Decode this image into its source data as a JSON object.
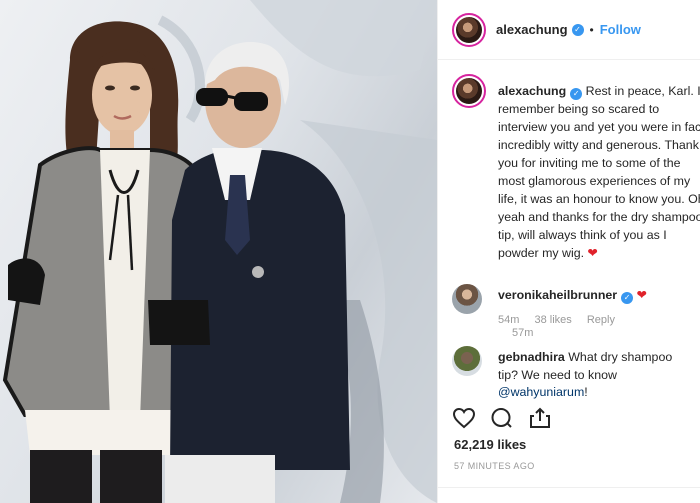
{
  "post": {
    "username": "alexachung",
    "follow_label": "Follow",
    "separator": "•",
    "verified_glyph": "✓"
  },
  "caption": {
    "username": "alexachung",
    "lines": [
      "Rest in peace, Karl. I",
      "remember being so scared to",
      "interview you and yet you were in fact",
      "incredibly witty and generous. Thank",
      "you for inviting me to some of the",
      "most glamorous experiences of my",
      "life, it was an honour to know you. Oh",
      "yeah and thanks for the dry shampoo",
      "tip, will always think of you as I",
      "powder my wig."
    ],
    "emoji": "❤",
    "time": "57m"
  },
  "comments": [
    {
      "username": "veronikaheilbrunner",
      "emoji": "❤",
      "time": "54m",
      "likes": "38 likes",
      "reply": "Reply"
    },
    {
      "username": "gebnadhira",
      "text_line1": "What dry shampoo",
      "text_line2": "tip? We need to know",
      "mention": "@wahyuniarum",
      "mention_suffix": "!"
    }
  ],
  "icons": [
    "heart-icon",
    "comment-icon",
    "share-icon"
  ],
  "likes_count": "62,219 likes",
  "posted_ago": "57 MINUTES AGO",
  "colors": {
    "accent_blue": "#3897f0",
    "heart_red": "#e0222b",
    "muted_gray": "#999999"
  }
}
